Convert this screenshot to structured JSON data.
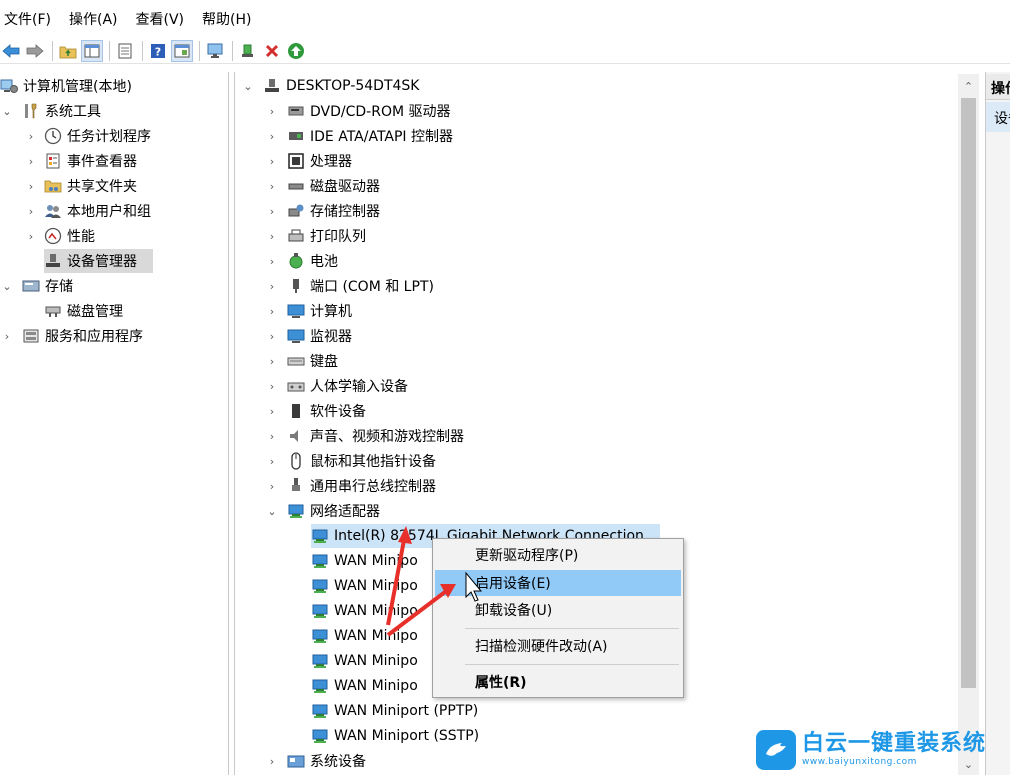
{
  "menu": [
    "文件(F)",
    "操作(A)",
    "查看(V)",
    "帮助(H)"
  ],
  "left_tree": {
    "root": "计算机管理(本地)",
    "system_tools": "系统工具",
    "task_scheduler": "任务计划程序",
    "event_viewer": "事件查看器",
    "shared_folders": "共享文件夹",
    "local_users": "本地用户和组",
    "performance": "性能",
    "device_manager": "设备管理器",
    "storage": "存储",
    "disk_management": "磁盘管理",
    "services": "服务和应用程序"
  },
  "device_tree": {
    "computer": "DESKTOP-54DT4SK",
    "categories": [
      "DVD/CD-ROM 驱动器",
      "IDE ATA/ATAPI 控制器",
      "处理器",
      "磁盘驱动器",
      "存储控制器",
      "打印队列",
      "电池",
      "端口 (COM 和 LPT)",
      "计算机",
      "监视器",
      "键盘",
      "人体学输入设备",
      "软件设备",
      "声音、视频和游戏控制器",
      "鼠标和其他指针设备",
      "通用串行总线控制器"
    ],
    "network_category": "网络适配器",
    "network_devices": [
      "Intel(R) 82574L Gigabit Network Connection",
      "WAN Minipo",
      "WAN Minipo",
      "WAN Minipo",
      "WAN Minipo",
      "WAN Minipo",
      "WAN Minipo",
      "WAN Miniport (PPTP)",
      "WAN Miniport (SSTP)"
    ],
    "last_category": "系统设备"
  },
  "context_menu": {
    "update_driver": "更新驱动程序(P)",
    "enable_device": "启用设备(E)",
    "uninstall_device": "卸载设备(U)",
    "scan_hardware": "扫描检测硬件改动(A)",
    "properties": "属性(R)"
  },
  "actions_pane": {
    "header": "操作",
    "item": "设备管理器"
  },
  "watermark": {
    "name": "白云一键重装系统",
    "url": "www.baiyunxitong.com"
  },
  "colors": {
    "highlight": "#cce4f7",
    "menu_hover": "#91c9f7",
    "arrow": "#e8302a",
    "brand": "#1e98e6"
  }
}
